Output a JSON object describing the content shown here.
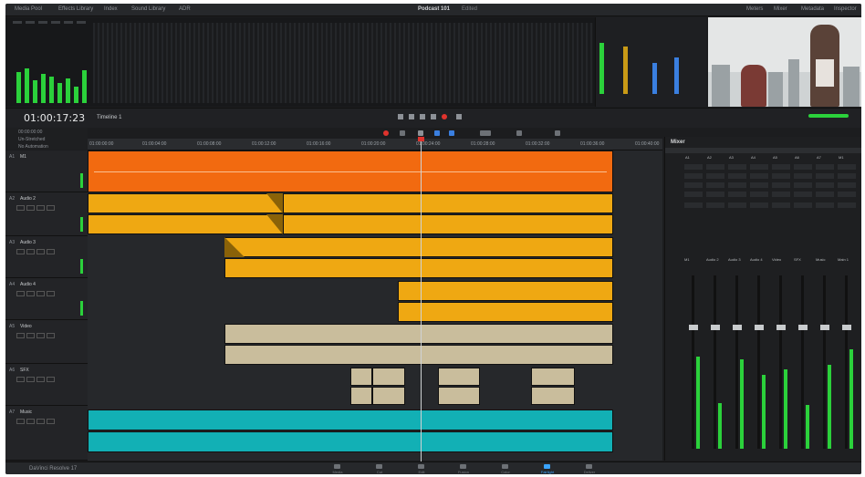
{
  "app": {
    "title": "Podcast 101",
    "title_suffix": "Edited",
    "menu": [
      "Media Pool",
      "Effects Library",
      "Index",
      "Sound Library",
      "ADR"
    ],
    "right_menu": [
      "Meters",
      "Mixer",
      "Metadata",
      "Inspector"
    ]
  },
  "transport": {
    "timecode": "01:00:17:23",
    "timeline_name": "Timeline 1"
  },
  "left_info": [
    "00:00:00:00",
    "Un-Stretched",
    "No Automation"
  ],
  "ruler": {
    "ticks": [
      "01:00:00:00",
      "01:00:04:00",
      "01:00:08:00",
      "01:00:12:00",
      "01:00:16:00",
      "01:00:20:00",
      "01:00:24:00",
      "01:00:28:00",
      "01:00:32:00",
      "01:00:36:00",
      "01:00:40:00"
    ]
  },
  "tracks": [
    {
      "id": "A1",
      "name": "M1"
    },
    {
      "id": "A2",
      "name": "Audio 2"
    },
    {
      "id": "A3",
      "name": "Audio 3"
    },
    {
      "id": "A4",
      "name": "Audio 4"
    },
    {
      "id": "A5",
      "name": "Video"
    },
    {
      "id": "A6",
      "name": "SFX"
    },
    {
      "id": "A7",
      "name": "Music"
    }
  ],
  "mixer": {
    "title": "Mixer",
    "channels": [
      "A1",
      "A2",
      "A3",
      "A4",
      "A5",
      "A6",
      "A7",
      "M1"
    ],
    "channel_names": [
      "M1",
      "Audio 2",
      "Audio 3",
      "Audio 4",
      "Video",
      "SFX",
      "Music",
      "Main 1"
    ],
    "levels": [
      0.72,
      0.36,
      0.7,
      0.58,
      0.62,
      0.34,
      0.66,
      0.78
    ]
  },
  "meters": {
    "levels": [
      0.38,
      0.42,
      0.28,
      0.36,
      0.32,
      0.24,
      0.3,
      0.2,
      0.4
    ]
  },
  "bottom": {
    "brand": "DaVinci Resolve 17",
    "pages": [
      "Media",
      "Cut",
      "Edit",
      "Fusion",
      "Color",
      "Fairlight",
      "Deliver"
    ],
    "active_page": "Fairlight"
  },
  "colors": {
    "clip_orange": "#f26a10",
    "clip_yellow": "#efa812",
    "clip_beige": "#c9bd9c",
    "clip_teal": "#12b0b5",
    "meter_green": "#2bd13b",
    "playhead_red": "#e0332d"
  }
}
